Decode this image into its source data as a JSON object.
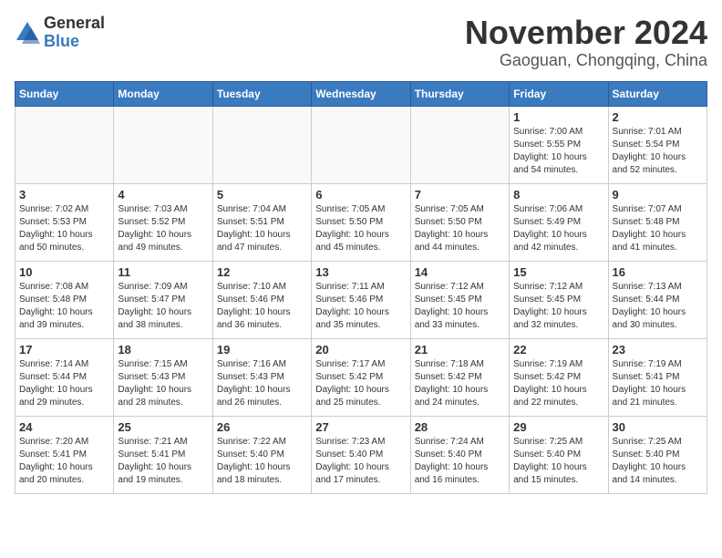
{
  "header": {
    "logo_general": "General",
    "logo_blue": "Blue",
    "month": "November 2024",
    "location": "Gaoguan, Chongqing, China"
  },
  "weekdays": [
    "Sunday",
    "Monday",
    "Tuesday",
    "Wednesday",
    "Thursday",
    "Friday",
    "Saturday"
  ],
  "weeks": [
    [
      {
        "day": "",
        "info": ""
      },
      {
        "day": "",
        "info": ""
      },
      {
        "day": "",
        "info": ""
      },
      {
        "day": "",
        "info": ""
      },
      {
        "day": "",
        "info": ""
      },
      {
        "day": "1",
        "info": "Sunrise: 7:00 AM\nSunset: 5:55 PM\nDaylight: 10 hours\nand 54 minutes."
      },
      {
        "day": "2",
        "info": "Sunrise: 7:01 AM\nSunset: 5:54 PM\nDaylight: 10 hours\nand 52 minutes."
      }
    ],
    [
      {
        "day": "3",
        "info": "Sunrise: 7:02 AM\nSunset: 5:53 PM\nDaylight: 10 hours\nand 50 minutes."
      },
      {
        "day": "4",
        "info": "Sunrise: 7:03 AM\nSunset: 5:52 PM\nDaylight: 10 hours\nand 49 minutes."
      },
      {
        "day": "5",
        "info": "Sunrise: 7:04 AM\nSunset: 5:51 PM\nDaylight: 10 hours\nand 47 minutes."
      },
      {
        "day": "6",
        "info": "Sunrise: 7:05 AM\nSunset: 5:50 PM\nDaylight: 10 hours\nand 45 minutes."
      },
      {
        "day": "7",
        "info": "Sunrise: 7:05 AM\nSunset: 5:50 PM\nDaylight: 10 hours\nand 44 minutes."
      },
      {
        "day": "8",
        "info": "Sunrise: 7:06 AM\nSunset: 5:49 PM\nDaylight: 10 hours\nand 42 minutes."
      },
      {
        "day": "9",
        "info": "Sunrise: 7:07 AM\nSunset: 5:48 PM\nDaylight: 10 hours\nand 41 minutes."
      }
    ],
    [
      {
        "day": "10",
        "info": "Sunrise: 7:08 AM\nSunset: 5:48 PM\nDaylight: 10 hours\nand 39 minutes."
      },
      {
        "day": "11",
        "info": "Sunrise: 7:09 AM\nSunset: 5:47 PM\nDaylight: 10 hours\nand 38 minutes."
      },
      {
        "day": "12",
        "info": "Sunrise: 7:10 AM\nSunset: 5:46 PM\nDaylight: 10 hours\nand 36 minutes."
      },
      {
        "day": "13",
        "info": "Sunrise: 7:11 AM\nSunset: 5:46 PM\nDaylight: 10 hours\nand 35 minutes."
      },
      {
        "day": "14",
        "info": "Sunrise: 7:12 AM\nSunset: 5:45 PM\nDaylight: 10 hours\nand 33 minutes."
      },
      {
        "day": "15",
        "info": "Sunrise: 7:12 AM\nSunset: 5:45 PM\nDaylight: 10 hours\nand 32 minutes."
      },
      {
        "day": "16",
        "info": "Sunrise: 7:13 AM\nSunset: 5:44 PM\nDaylight: 10 hours\nand 30 minutes."
      }
    ],
    [
      {
        "day": "17",
        "info": "Sunrise: 7:14 AM\nSunset: 5:44 PM\nDaylight: 10 hours\nand 29 minutes."
      },
      {
        "day": "18",
        "info": "Sunrise: 7:15 AM\nSunset: 5:43 PM\nDaylight: 10 hours\nand 28 minutes."
      },
      {
        "day": "19",
        "info": "Sunrise: 7:16 AM\nSunset: 5:43 PM\nDaylight: 10 hours\nand 26 minutes."
      },
      {
        "day": "20",
        "info": "Sunrise: 7:17 AM\nSunset: 5:42 PM\nDaylight: 10 hours\nand 25 minutes."
      },
      {
        "day": "21",
        "info": "Sunrise: 7:18 AM\nSunset: 5:42 PM\nDaylight: 10 hours\nand 24 minutes."
      },
      {
        "day": "22",
        "info": "Sunrise: 7:19 AM\nSunset: 5:42 PM\nDaylight: 10 hours\nand 22 minutes."
      },
      {
        "day": "23",
        "info": "Sunrise: 7:19 AM\nSunset: 5:41 PM\nDaylight: 10 hours\nand 21 minutes."
      }
    ],
    [
      {
        "day": "24",
        "info": "Sunrise: 7:20 AM\nSunset: 5:41 PM\nDaylight: 10 hours\nand 20 minutes."
      },
      {
        "day": "25",
        "info": "Sunrise: 7:21 AM\nSunset: 5:41 PM\nDaylight: 10 hours\nand 19 minutes."
      },
      {
        "day": "26",
        "info": "Sunrise: 7:22 AM\nSunset: 5:40 PM\nDaylight: 10 hours\nand 18 minutes."
      },
      {
        "day": "27",
        "info": "Sunrise: 7:23 AM\nSunset: 5:40 PM\nDaylight: 10 hours\nand 17 minutes."
      },
      {
        "day": "28",
        "info": "Sunrise: 7:24 AM\nSunset: 5:40 PM\nDaylight: 10 hours\nand 16 minutes."
      },
      {
        "day": "29",
        "info": "Sunrise: 7:25 AM\nSunset: 5:40 PM\nDaylight: 10 hours\nand 15 minutes."
      },
      {
        "day": "30",
        "info": "Sunrise: 7:25 AM\nSunset: 5:40 PM\nDaylight: 10 hours\nand 14 minutes."
      }
    ]
  ]
}
